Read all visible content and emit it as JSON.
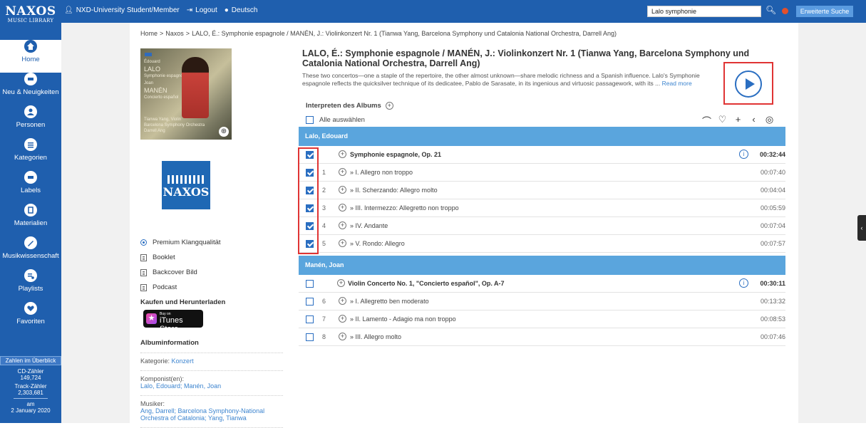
{
  "header": {
    "logo_line1": "NAXOS",
    "logo_line2": "MUSIC LIBRARY",
    "user_label": "NXD-University Student/Member",
    "logout_label": "Logout",
    "language_label": "Deutsch",
    "search_value": "Lalo symphonie",
    "advanced_search_label": "Erweiterte Suche"
  },
  "sidebar": {
    "items": [
      {
        "label": "Home",
        "icon": "home-icon"
      },
      {
        "label": "Neu & Neuigkeiten",
        "icon": "new-icon"
      },
      {
        "label": "Personen",
        "icon": "person-icon"
      },
      {
        "label": "Kategorien",
        "icon": "category-icon"
      },
      {
        "label": "Labels",
        "icon": "label-icon"
      },
      {
        "label": "Materialien",
        "icon": "materials-icon"
      },
      {
        "label": "Musikwissenschaft",
        "icon": "musicology-icon"
      },
      {
        "label": "Playlists",
        "icon": "playlist-icon"
      },
      {
        "label": "Favoriten",
        "icon": "heart-icon"
      }
    ],
    "stats": {
      "header": "Zahlen im Überblick",
      "cd_label": "CD-Zähler",
      "cd_value": "149,724",
      "track_label": "Track-Zähler",
      "track_value": "2,303,681",
      "date_prefix": "am",
      "date_value": "2 January 2020"
    }
  },
  "breadcrumb": {
    "home": "Home",
    "naxos": "Naxos",
    "current": "LALO, É.: Symphonie espagnole / MANÉN, J.: Violinkonzert Nr. 1 (Tianwa Yang, Barcelona Symphony und Catalonia National Orchestra, Darrell Ang)"
  },
  "cover": {
    "line1": "Édouard",
    "line2": "LALO",
    "line3": "Symphonie espagnole",
    "line4": "Joan",
    "line5": "MANÉN",
    "line6": "Concierto español",
    "bottom1": "Tianwa Yang, Violin",
    "bottom2": "Barcelona Symphony Orchestra",
    "bottom3": "Darrell Ang",
    "label_logo": "NAXOS"
  },
  "left_links": {
    "premium": "Premium Klangqualität",
    "booklet": "Booklet",
    "backcover": "Backcover Bild",
    "podcast": "Podcast",
    "buy_title": "Kaufen und Herunterladen",
    "itunes_small": "Buy on",
    "itunes_big": "iTunes Store"
  },
  "album_info": {
    "title": "Albuminformation",
    "category_label": "Kategorie:",
    "category_value": "Konzert",
    "composer_label": "Komponist(en):",
    "composer_value": "Lalo, Edouard; Manén, Joan",
    "musicians_label": "Musiker:",
    "musicians_value": "Ang, Darrell; Barcelona Symphony-National Orchestra of Catalonia; Yang, Tianwa"
  },
  "album": {
    "title": "LALO, É.: Symphonie espagnole / MANÉN, J.: Violinkonzert Nr. 1 (Tianwa Yang, Barcelona Symphony und Catalonia National Orchestra, Darrell Ang)",
    "description": "These two concertos—one a staple of the repertoire, the other almost unknown—share melodic richness and a Spanish influence. Lalo's Symphonie espagnole reflects the quicksilver technique of its dedicatee, Pablo de Sarasate, in its ingenious and virtuosic passagework, with its ...",
    "read_more": "Read more",
    "performers_label": "Interpreten des Albums",
    "select_all_label": "Alle auswählen"
  },
  "groups": [
    {
      "composer": "Lalo, Edouard",
      "work": {
        "title": "Symphonie espagnole, Op. 21",
        "duration": "00:32:44",
        "checked": true
      },
      "tracks": [
        {
          "num": "1",
          "title": "» I. Allegro non troppo",
          "duration": "00:07:40",
          "checked": true
        },
        {
          "num": "2",
          "title": "» II. Scherzando: Allegro molto",
          "duration": "00:04:04",
          "checked": true
        },
        {
          "num": "3",
          "title": "» III. Intermezzo: Allegretto non troppo",
          "duration": "00:05:59",
          "checked": true
        },
        {
          "num": "4",
          "title": "» IV. Andante",
          "duration": "00:07:04",
          "checked": true
        },
        {
          "num": "5",
          "title": "» V. Rondo: Allegro",
          "duration": "00:07:57",
          "checked": true
        }
      ]
    },
    {
      "composer": "Manén, Joan",
      "work": {
        "title": "Violin Concerto No. 1, \"Concierto español\", Op. A-7",
        "duration": "00:30:11",
        "checked": false
      },
      "tracks": [
        {
          "num": "6",
          "title": "» I. Allegretto ben moderato",
          "duration": "00:13:32",
          "checked": false
        },
        {
          "num": "7",
          "title": "» II. Lamento - Adagio ma non troppo",
          "duration": "00:08:53",
          "checked": false
        },
        {
          "num": "8",
          "title": "» III. Allegro molto",
          "duration": "00:07:46",
          "checked": false
        }
      ]
    }
  ]
}
